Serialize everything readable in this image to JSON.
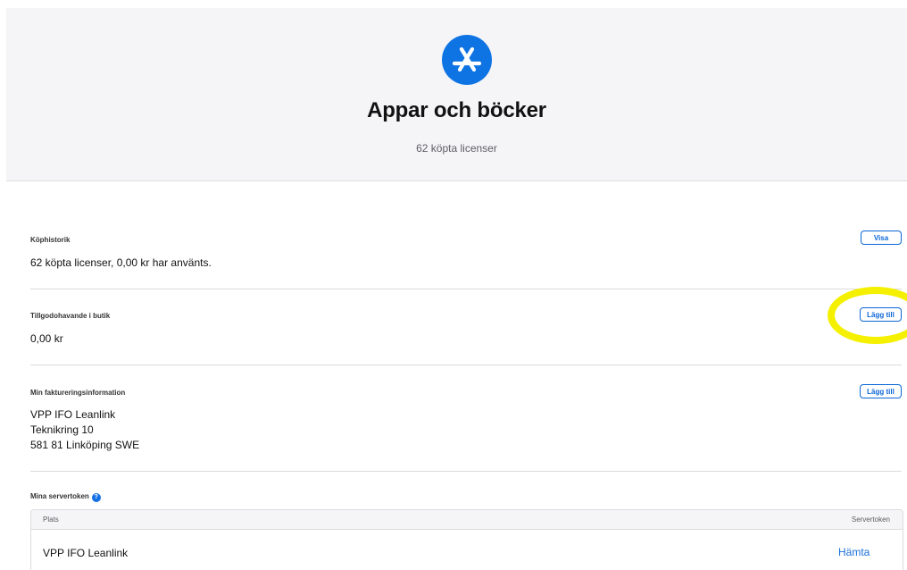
{
  "hero": {
    "icon": "app-store-icon",
    "title": "Appar och böcker",
    "subtitle": "62 köpta licenser",
    "accent_color": "#0f74e3"
  },
  "purchase_history": {
    "label": "Köphistorik",
    "value": "62 köpta licenser, 0,00 kr har använts.",
    "button": "Visa"
  },
  "store_credit": {
    "label": "Tillgodohavande i butik",
    "value": "0,00 kr",
    "button": "Lägg till"
  },
  "billing": {
    "label": "Min faktureringsinformation",
    "lines": [
      "VPP IFO Leanlink",
      "Teknikring 10",
      "581 81 Linköping SWE"
    ],
    "button": "Lägg till"
  },
  "server_tokens": {
    "label": "Mina servertoken",
    "help_icon": "question-circle-icon",
    "columns": [
      "Plats",
      "Servertoken"
    ],
    "rows": [
      {
        "location": "VPP IFO Leanlink",
        "action": "Hämta"
      }
    ]
  },
  "annotation": {
    "color": "#f4f000",
    "shape": "circle-highlight"
  }
}
